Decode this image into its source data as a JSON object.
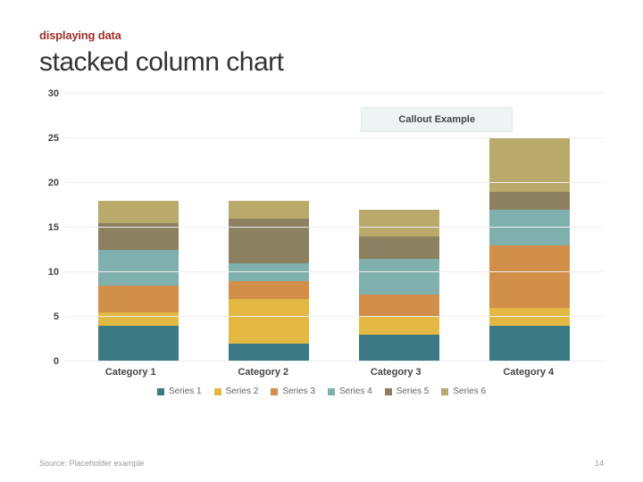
{
  "eyebrow": "displaying data",
  "title": "stacked column chart",
  "callout": "Callout Example",
  "source": "Source: Placeholder example",
  "page_number": "14",
  "chart_data": {
    "type": "bar",
    "stacked": true,
    "categories": [
      "Category 1",
      "Category 2",
      "Category 3",
      "Category 4"
    ],
    "series": [
      {
        "name": "Series 1",
        "color": "#3b7a85",
        "values": [
          4.0,
          2.0,
          3.0,
          4.0
        ]
      },
      {
        "name": "Series 2",
        "color": "#e4b943",
        "values": [
          1.5,
          5.0,
          2.0,
          2.0
        ]
      },
      {
        "name": "Series 3",
        "color": "#d18f4a",
        "values": [
          3.0,
          2.0,
          2.5,
          7.0
        ]
      },
      {
        "name": "Series 4",
        "color": "#7fb0ad",
        "values": [
          4.0,
          2.0,
          4.0,
          4.0
        ]
      },
      {
        "name": "Series 5",
        "color": "#8b8060",
        "values": [
          3.0,
          5.0,
          2.5,
          2.0
        ]
      },
      {
        "name": "Series 6",
        "color": "#b9a96b",
        "values": [
          2.5,
          2.0,
          3.0,
          6.0
        ]
      }
    ],
    "ylim": [
      0,
      30
    ],
    "y_ticks": [
      0,
      5,
      10,
      15,
      20,
      25,
      30
    ],
    "xlabel": "",
    "ylabel": "",
    "title": ""
  }
}
